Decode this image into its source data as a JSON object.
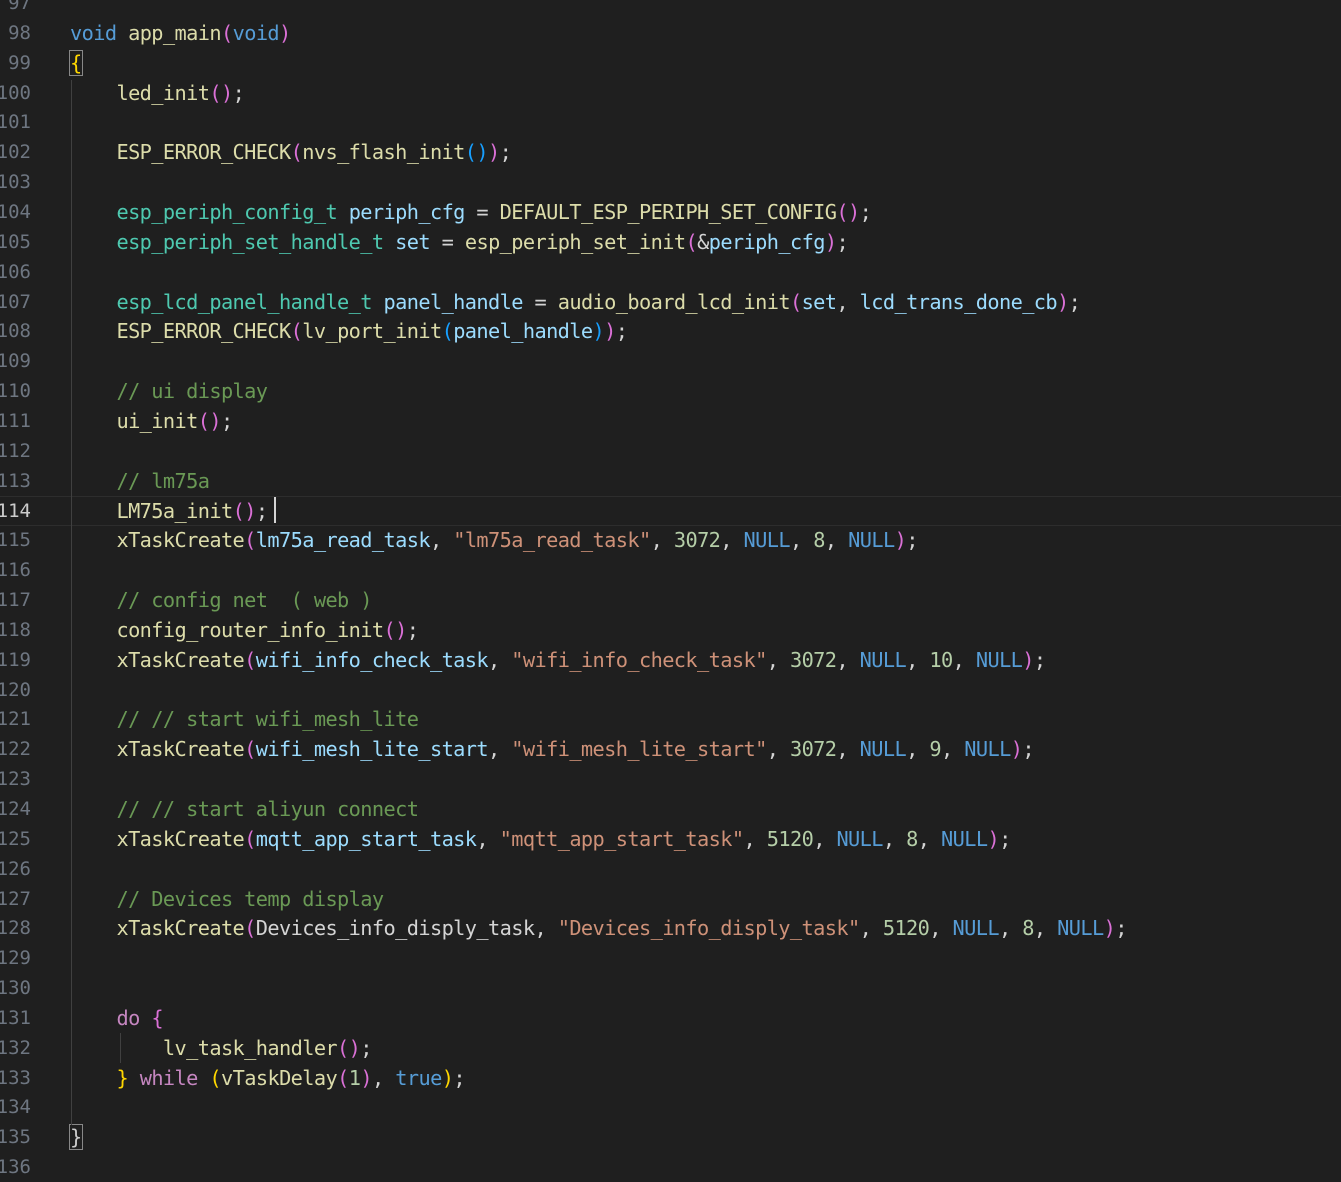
{
  "editor": {
    "current_line": "114",
    "lines": [
      {
        "num": "97",
        "text": ""
      },
      {
        "num": "98",
        "text": "void app_main(void)"
      },
      {
        "num": "99",
        "text": "{"
      },
      {
        "num": "100",
        "text": "    led_init();"
      },
      {
        "num": "101",
        "text": ""
      },
      {
        "num": "102",
        "text": "    ESP_ERROR_CHECK(nvs_flash_init());"
      },
      {
        "num": "103",
        "text": ""
      },
      {
        "num": "104",
        "text": "    esp_periph_config_t periph_cfg = DEFAULT_ESP_PERIPH_SET_CONFIG();"
      },
      {
        "num": "105",
        "text": "    esp_periph_set_handle_t set = esp_periph_set_init(&periph_cfg);"
      },
      {
        "num": "106",
        "text": ""
      },
      {
        "num": "107",
        "text": "    esp_lcd_panel_handle_t panel_handle = audio_board_lcd_init(set, lcd_trans_done_cb);"
      },
      {
        "num": "108",
        "text": "    ESP_ERROR_CHECK(lv_port_init(panel_handle));"
      },
      {
        "num": "109",
        "text": ""
      },
      {
        "num": "110",
        "text": "    // ui display"
      },
      {
        "num": "111",
        "text": "    ui_init();"
      },
      {
        "num": "112",
        "text": ""
      },
      {
        "num": "113",
        "text": "    // lm75a"
      },
      {
        "num": "114",
        "text": "    LM75a_init();"
      },
      {
        "num": "115",
        "text": "    xTaskCreate(lm75a_read_task, \"lm75a_read_task\", 3072, NULL, 8, NULL);"
      },
      {
        "num": "116",
        "text": ""
      },
      {
        "num": "117",
        "text": "    // config net  ( web )"
      },
      {
        "num": "118",
        "text": "    config_router_info_init();"
      },
      {
        "num": "119",
        "text": "    xTaskCreate(wifi_info_check_task, \"wifi_info_check_task\", 3072, NULL, 10, NULL);"
      },
      {
        "num": "120",
        "text": ""
      },
      {
        "num": "121",
        "text": "    // // start wifi_mesh_lite"
      },
      {
        "num": "122",
        "text": "    xTaskCreate(wifi_mesh_lite_start, \"wifi_mesh_lite_start\", 3072, NULL, 9, NULL);"
      },
      {
        "num": "123",
        "text": ""
      },
      {
        "num": "124",
        "text": "    // // start aliyun connect"
      },
      {
        "num": "125",
        "text": "    xTaskCreate(mqtt_app_start_task, \"mqtt_app_start_task\", 5120, NULL, 8, NULL);"
      },
      {
        "num": "126",
        "text": ""
      },
      {
        "num": "127",
        "text": "    // Devices temp display"
      },
      {
        "num": "128",
        "text": "    xTaskCreate(Devices_info_disply_task, \"Devices_info_disply_task\", 5120, NULL, 8, NULL);"
      },
      {
        "num": "129",
        "text": ""
      },
      {
        "num": "130",
        "text": ""
      },
      {
        "num": "131",
        "text": "    do {"
      },
      {
        "num": "132",
        "text": "        lv_task_handler();"
      },
      {
        "num": "133",
        "text": "    } while (vTaskDelay(1), true);"
      },
      {
        "num": "134",
        "text": ""
      },
      {
        "num": "135",
        "text": "}"
      },
      {
        "num": "136",
        "text": ""
      }
    ]
  }
}
